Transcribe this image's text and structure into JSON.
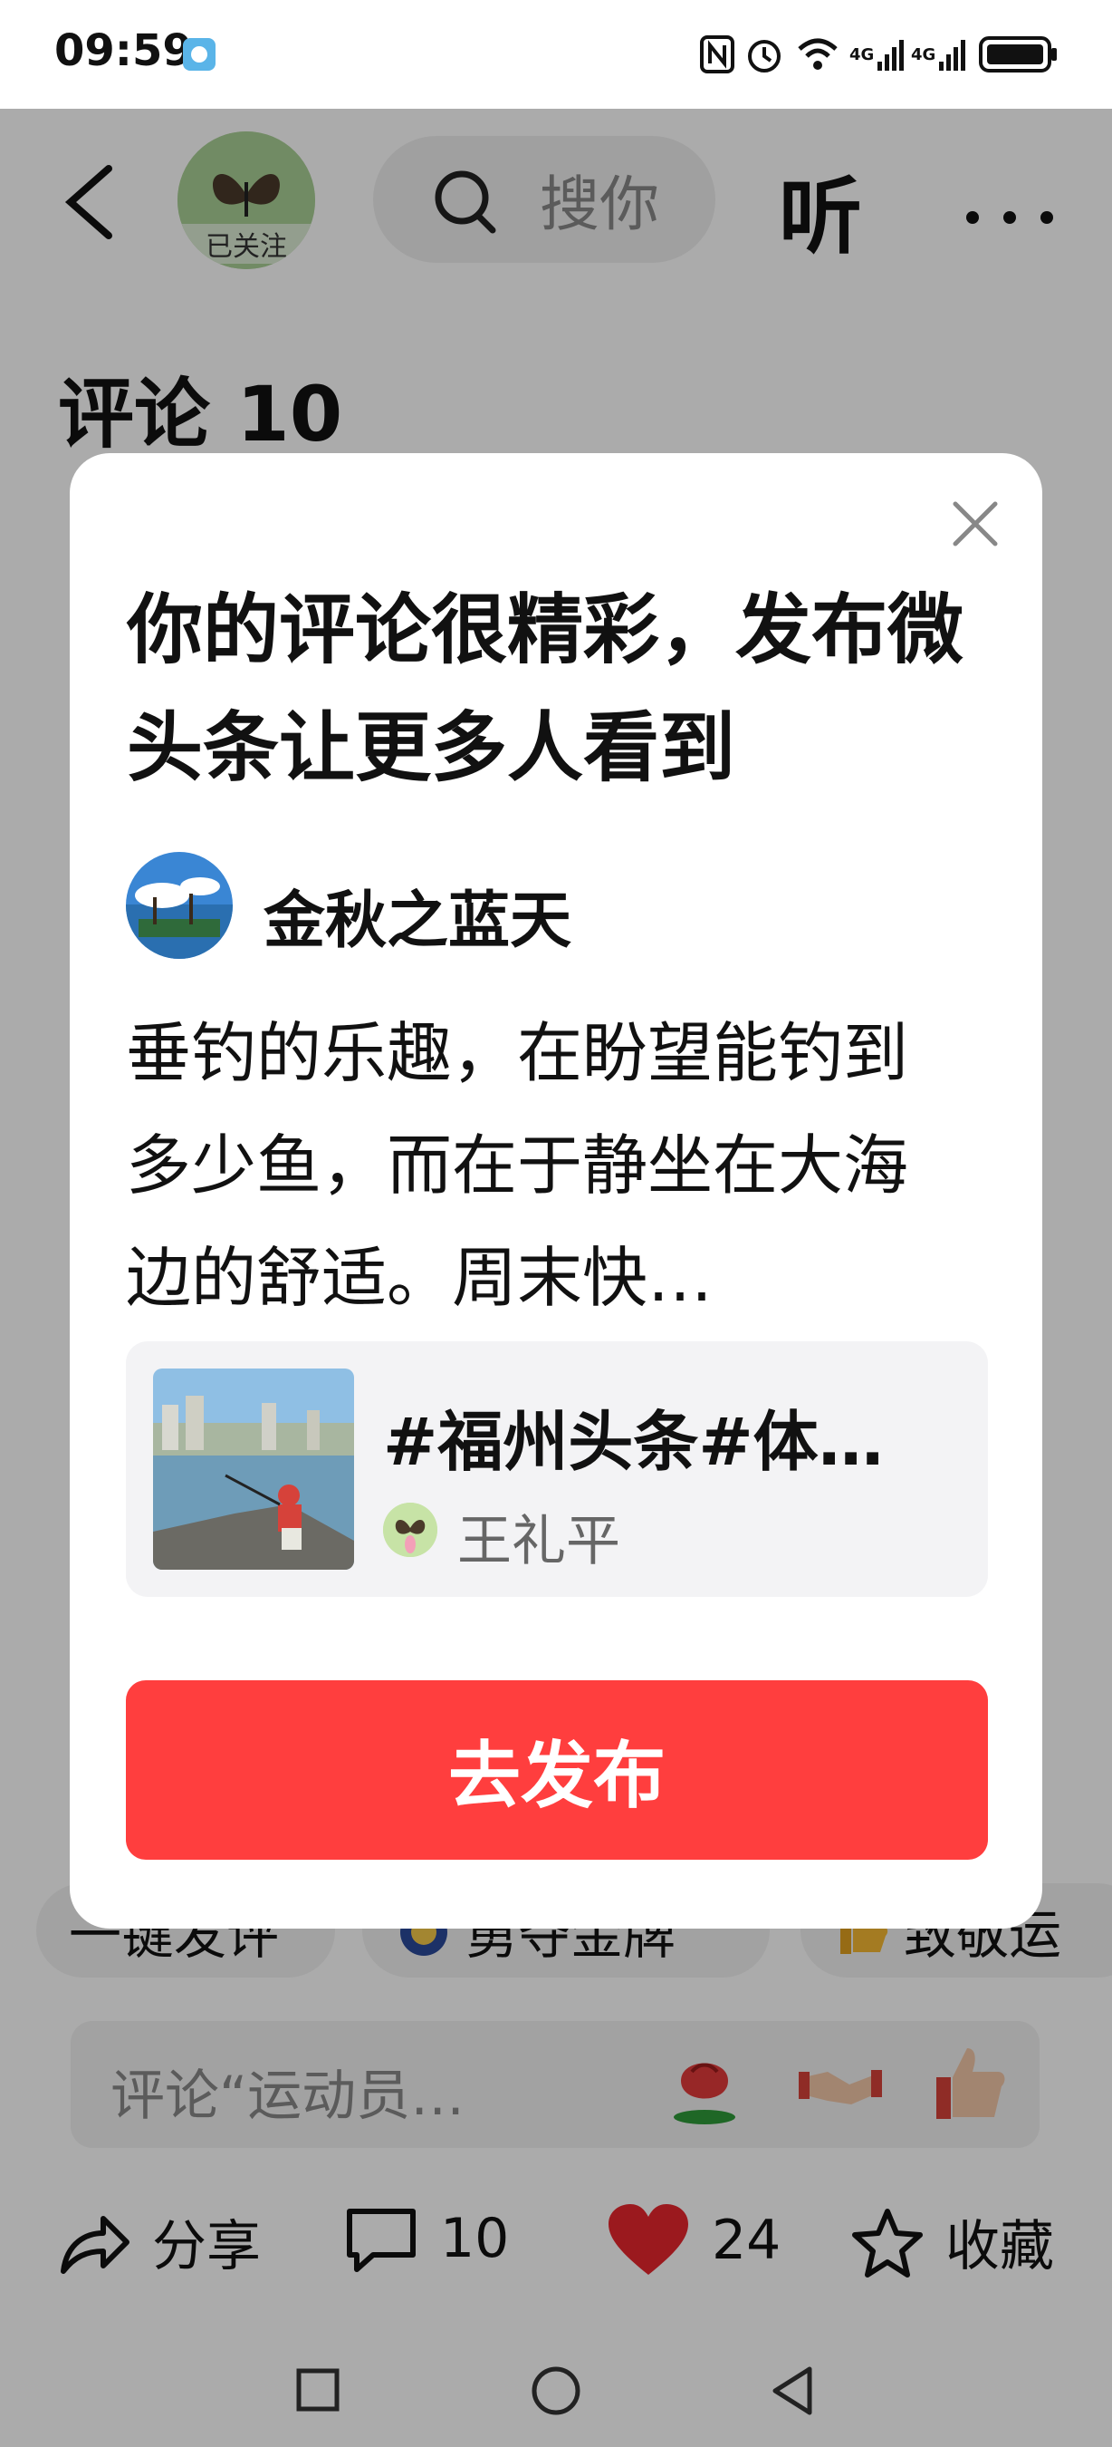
{
  "status_bar": {
    "time": "09:59",
    "signal_labels": [
      "4G",
      "4G"
    ]
  },
  "header": {
    "follow_label": "已关注",
    "search_placeholder": "搜你",
    "listen_label": "听"
  },
  "comments": {
    "title": "评论 10"
  },
  "quick_chips": [
    "一键发评",
    "勇夺金牌",
    "致敬运"
  ],
  "comment_input": {
    "placeholder": "评论“运动员…"
  },
  "action_bar": {
    "share_label": "分享",
    "comment_count": "10",
    "like_count": "24",
    "collect_label": "收藏"
  },
  "modal": {
    "title": "你的评论很精彩，发布微头条让更多人看到",
    "author_name": "金秋之蓝天",
    "comment_text": "垂钓的乐趣，在盼望能钓到多少鱼，而在于静坐在大海边的舒适。周末快…",
    "article": {
      "title": "#福州头条#体…",
      "author": "王礼平"
    },
    "publish_button": "去发布"
  },
  "colors": {
    "primary_red": "#ff3e3e",
    "like_red": "#e8262e"
  }
}
